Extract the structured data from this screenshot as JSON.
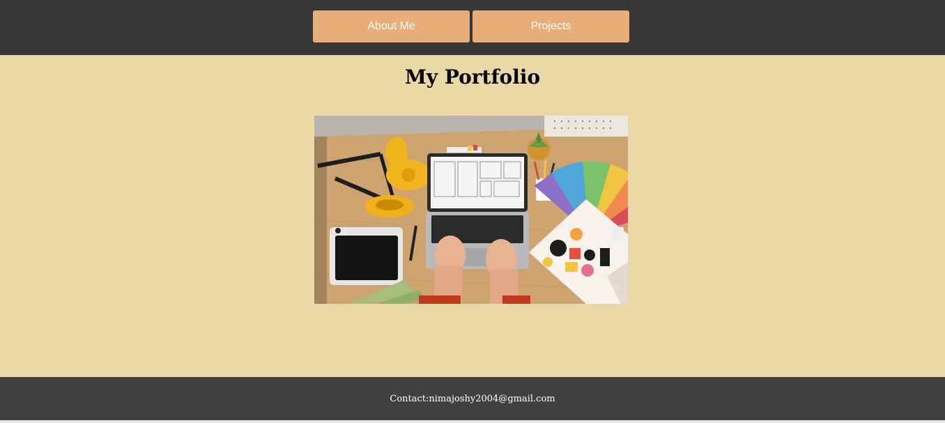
{
  "nav": {
    "items": [
      {
        "label": "About Me"
      },
      {
        "label": "Projects"
      }
    ]
  },
  "main": {
    "title": "My Portfolio",
    "hero_image": {
      "subject": "designer workspace with laptop, desk lamp, graphics tablet and color swatches"
    }
  },
  "footer": {
    "contact": "Contact:nimajoshy2004@gmail.com"
  },
  "colors": {
    "topbar": "#383535",
    "nav_button": "#e8ad78",
    "page_background": "#ead9a7",
    "footer": "#414141"
  }
}
